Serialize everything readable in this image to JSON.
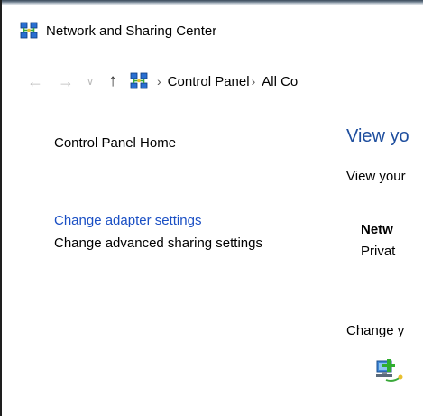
{
  "window": {
    "title": "Network and Sharing Center",
    "title_icon": "network-sharing-icon"
  },
  "navigation": {
    "back_icon": "back-arrow-icon",
    "forward_icon": "forward-arrow-icon",
    "recent_icon": "chevron-down-icon",
    "up_icon": "up-arrow-icon",
    "location_icon": "network-sharing-icon",
    "separator": "›",
    "breadcrumbs": [
      "Control Panel",
      "All Co"
    ]
  },
  "left_pane": {
    "home": "Control Panel Home",
    "links": [
      "Change adapter settings",
      "Change advanced sharing settings"
    ]
  },
  "main": {
    "heading": "View yo",
    "subheading": "View your",
    "network_name": "Netw",
    "network_category": "Privat",
    "change_label": "Change y",
    "setup_icon": "new-connection-icon"
  },
  "colors": {
    "link": "#1a4fc4",
    "heading": "#1e4e9e",
    "nav_disabled": "#b8b8b8"
  }
}
